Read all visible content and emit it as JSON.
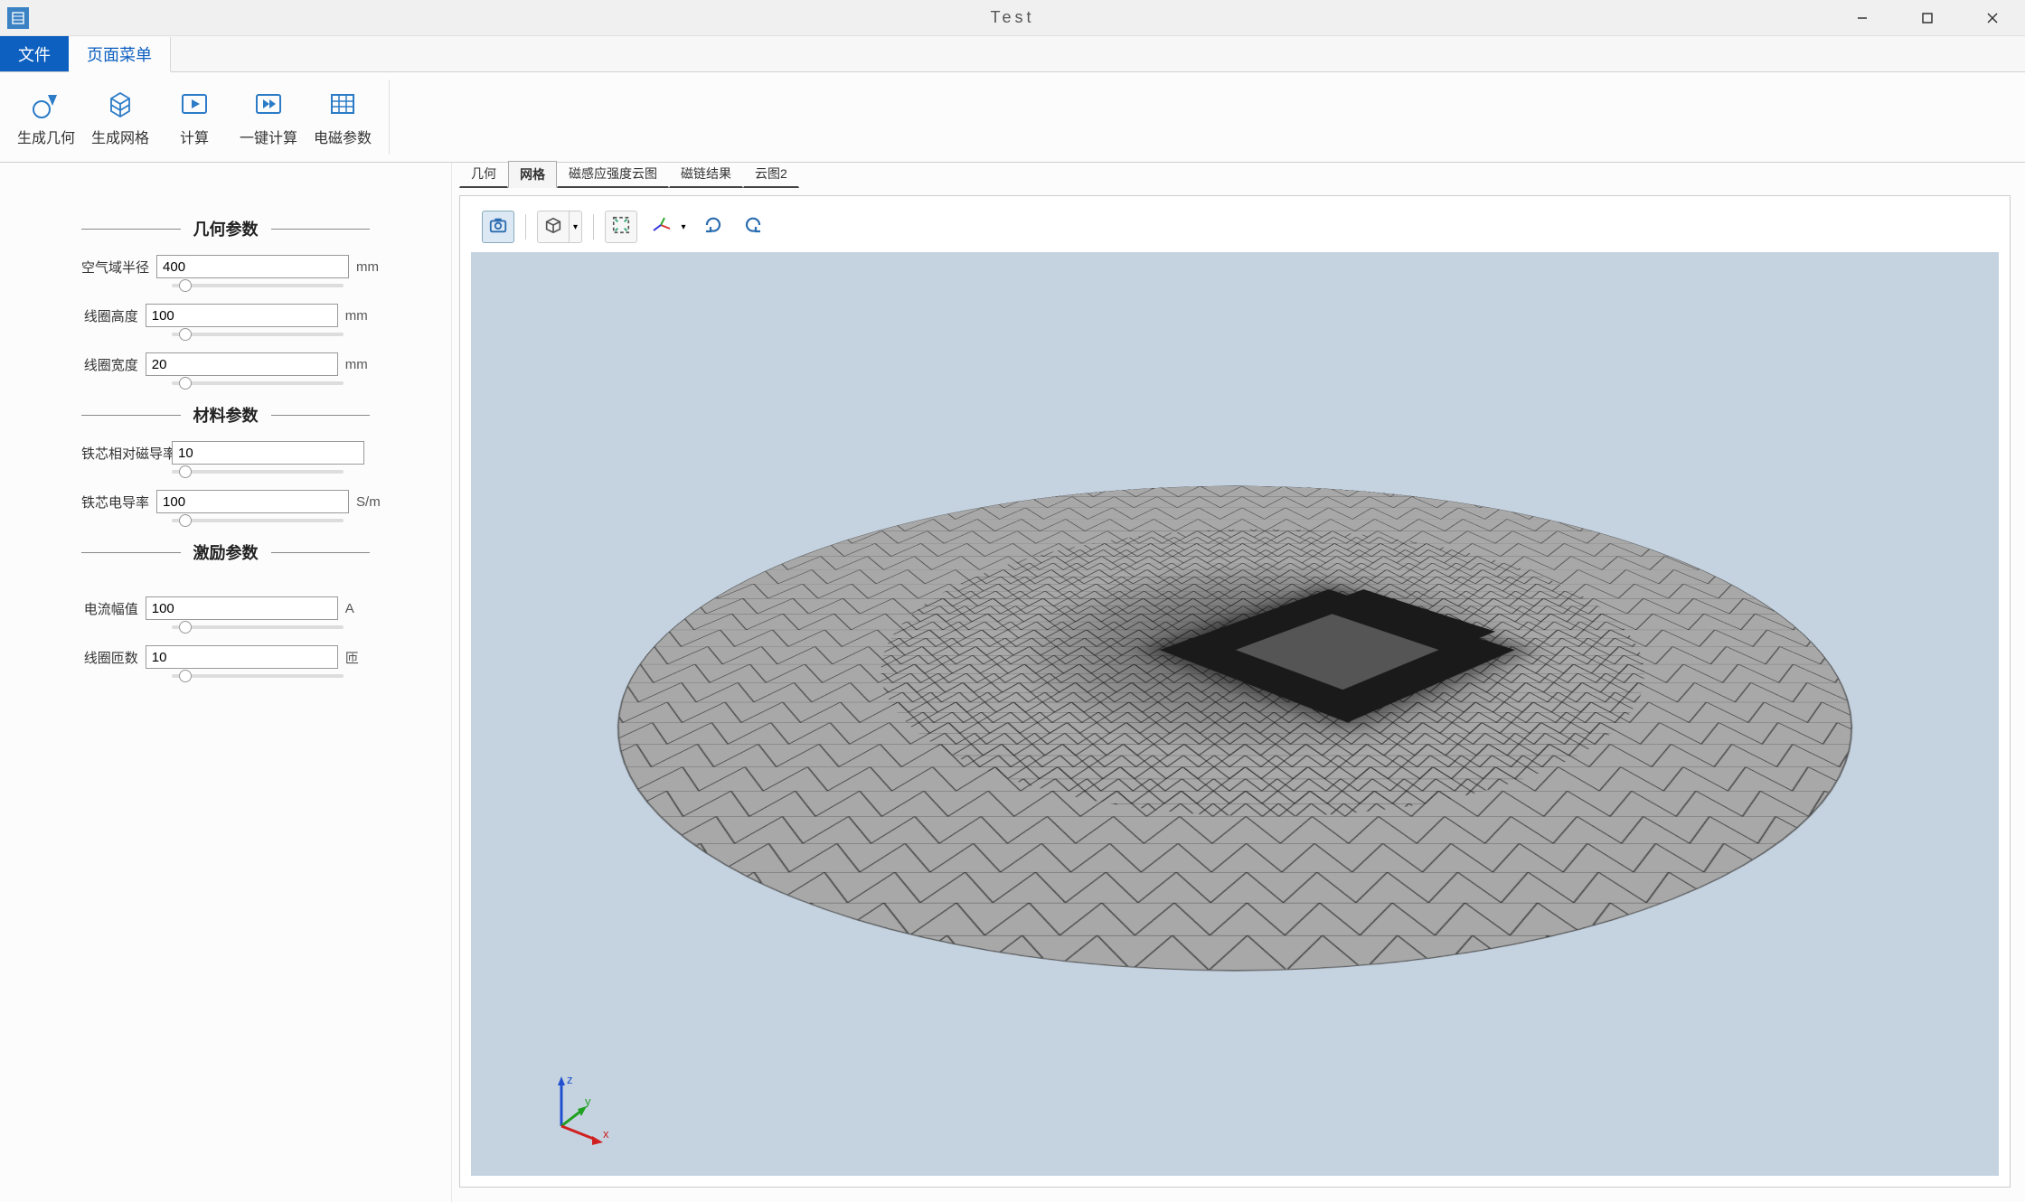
{
  "window": {
    "title": "Test"
  },
  "menuTabs": {
    "file": "文件",
    "page": "页面菜单"
  },
  "ribbon": {
    "genGeom": "生成几何",
    "genMesh": "生成网格",
    "compute": "计算",
    "oneClick": "一键计算",
    "emParams": "电磁参数"
  },
  "sidebar": {
    "sections": {
      "geometry": "几何参数",
      "material": "材料参数",
      "excitation": "激励参数"
    },
    "params": {
      "airRadius": {
        "label": "空气域半径",
        "value": "400",
        "unit": "mm"
      },
      "coilHeight": {
        "label": "线圈高度",
        "value": "100",
        "unit": "mm"
      },
      "coilWidth": {
        "label": "线圈宽度",
        "value": "20",
        "unit": "mm"
      },
      "corePerm": {
        "label": "铁芯相对磁导率",
        "value": "10",
        "unit": ""
      },
      "coreCond": {
        "label": "铁芯电导率",
        "value": "100",
        "unit": "S/m"
      },
      "currentAmp": {
        "label": "电流幅值",
        "value": "100",
        "unit": "A"
      },
      "coilTurns": {
        "label": "线圈匝数",
        "value": "10",
        "unit": "匝"
      }
    }
  },
  "contentTabs": {
    "geometry": "几何",
    "mesh": "网格",
    "fluxDensity": "磁感应强度云图",
    "fluxLinkage": "磁链结果",
    "cloud2": "云图2"
  },
  "axes": {
    "x": "x",
    "y": "y",
    "z": "z"
  }
}
